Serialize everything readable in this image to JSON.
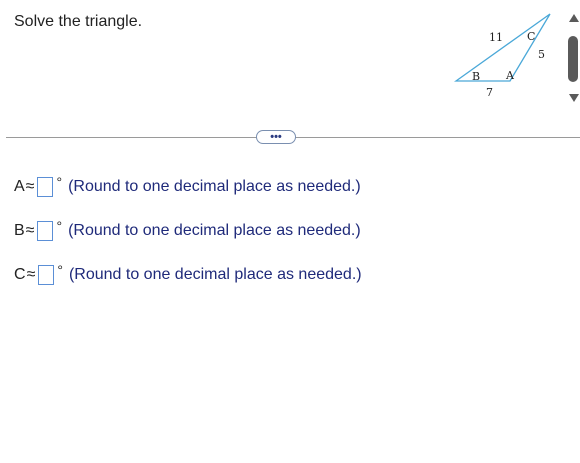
{
  "prompt": "Solve the triangle.",
  "triangle": {
    "vertex_labels": {
      "A": "A",
      "B": "B",
      "C": "C"
    },
    "side_labels": {
      "top": "11",
      "right": "5",
      "bottom": "7"
    },
    "stroke_color": "#4aa8d8"
  },
  "more_button": "•••",
  "rows": [
    {
      "angle": "A",
      "approx": "≈",
      "degree": "°",
      "hint": "(Round to one decimal place as needed.)"
    },
    {
      "angle": "B",
      "approx": "≈",
      "degree": "°",
      "hint": "(Round to one decimal place as needed.)"
    },
    {
      "angle": "C",
      "approx": "≈",
      "degree": "°",
      "hint": "(Round to one decimal place as needed.)"
    }
  ],
  "colors": {
    "hint_text": "#1f2a7a",
    "input_border": "#5b8fd6"
  }
}
